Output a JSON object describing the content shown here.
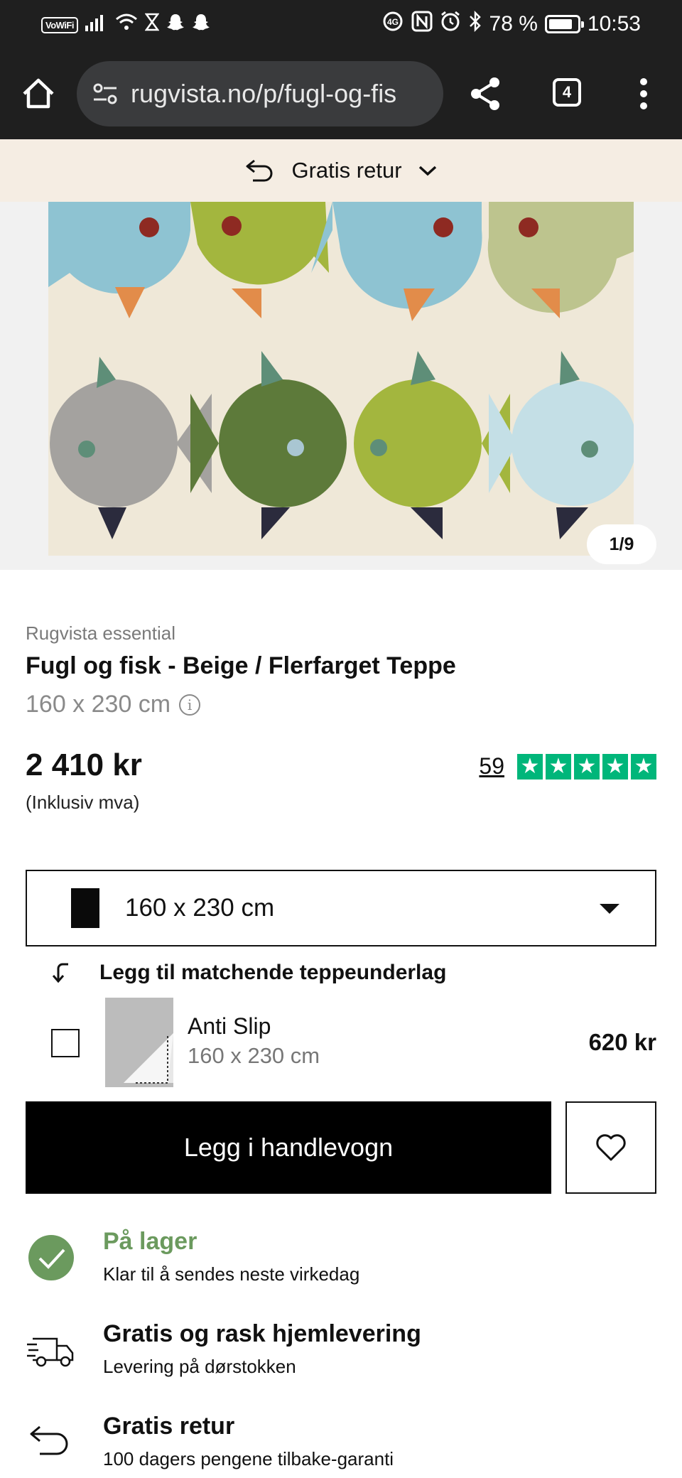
{
  "status_bar": {
    "vowifi": "VoWiFi",
    "battery": "78 %",
    "time": "10:53"
  },
  "browser": {
    "url": "rugvista.no/p/fugl-og-fis",
    "tab_count": "4"
  },
  "promo": {
    "label": "Gratis retur"
  },
  "gallery": {
    "counter": "1/9"
  },
  "product": {
    "brand": "Rugvista essential",
    "title": "Fugl og fisk - Beige / Flerfarget Teppe",
    "size": "160 x 230 cm",
    "price": "2 410 kr",
    "vat_note": "(Inklusiv mva)",
    "review_count": "59",
    "rating_stars": 5
  },
  "size_select": {
    "value": "160 x 230 cm"
  },
  "underlay": {
    "heading": "Legg til matchende teppeunderlag",
    "name": "Anti Slip",
    "size": "160 x 230 cm",
    "price": "620 kr",
    "checked": false
  },
  "cart": {
    "button_label": "Legg i handlevogn"
  },
  "usps": [
    {
      "title": "På lager",
      "subtitle": "Klar til å sendes neste virkedag",
      "icon": "check-circle-icon"
    },
    {
      "title": "Gratis og rask hjemlevering",
      "subtitle": "Levering på dørstokken",
      "icon": "delivery-truck-icon"
    },
    {
      "title": "Gratis retur",
      "subtitle": "100 dagers pengene tilbake-garanti",
      "icon": "return-arrow-icon"
    }
  ],
  "colors": {
    "trustpilot_green": "#00b67a",
    "stock_green": "#6b9a5e",
    "promo_bg": "#f5ede3",
    "browser_bg": "#1f1f1f"
  }
}
